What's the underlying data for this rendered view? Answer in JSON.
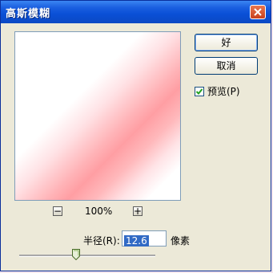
{
  "window": {
    "title": "高斯模糊"
  },
  "buttons": {
    "ok_label": "好",
    "cancel_label": "取消"
  },
  "preview_option": {
    "label": "预览(P)",
    "checked": true
  },
  "zoom": {
    "minus": "−",
    "plus": "+",
    "value": "100%"
  },
  "radius": {
    "label": "半径(R):",
    "value": "12.6",
    "unit": "像素"
  },
  "colors": {
    "title_bar": "#0a4fd6",
    "preview_blur": "#ff9ea3",
    "dialog_bg": "#ece9d8"
  },
  "slider": {
    "position_fraction": 0.42
  }
}
